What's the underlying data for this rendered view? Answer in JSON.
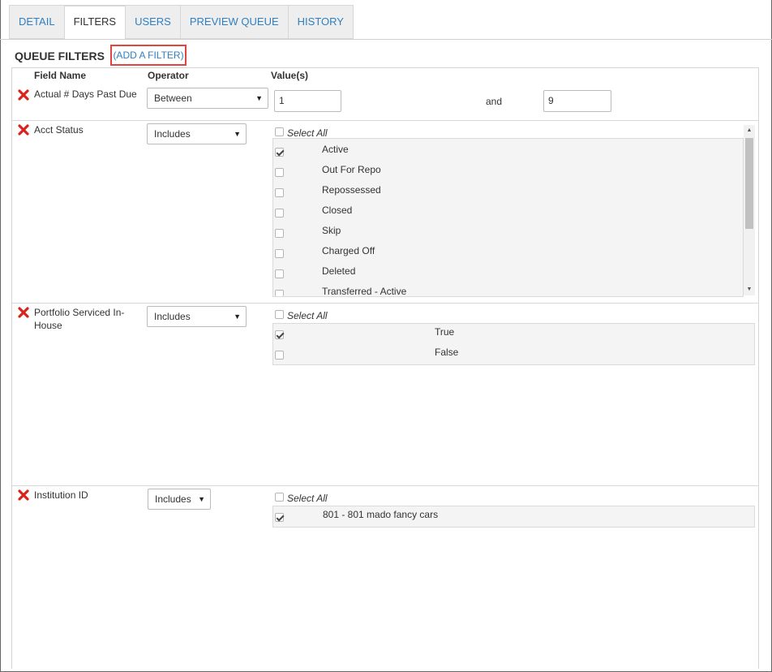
{
  "tabs": [
    {
      "label": "DETAIL",
      "active": false
    },
    {
      "label": "FILTERS",
      "active": true
    },
    {
      "label": "USERS",
      "active": false
    },
    {
      "label": "PREVIEW QUEUE",
      "active": false
    },
    {
      "label": "HISTORY",
      "active": false
    }
  ],
  "queue_filters": {
    "title": "QUEUE FILTERS",
    "add_filter_label": "(ADD A FILTER)"
  },
  "columns": {
    "field_name": "Field Name",
    "operator": "Operator",
    "values": "Value(s)"
  },
  "filters": {
    "days_past_due": {
      "field_name": "Actual # Days Past Due",
      "operator": "Between",
      "value_from": "1",
      "and_label": "and",
      "value_to": "9"
    },
    "acct_status": {
      "field_name": "Acct Status",
      "operator": "Includes",
      "select_all_label": "Select All",
      "options": [
        {
          "label": "Active",
          "checked": true
        },
        {
          "label": "Out For Repo",
          "checked": false
        },
        {
          "label": "Repossessed",
          "checked": false
        },
        {
          "label": "Closed",
          "checked": false
        },
        {
          "label": "Skip",
          "checked": false
        },
        {
          "label": "Charged Off",
          "checked": false
        },
        {
          "label": "Deleted",
          "checked": false
        },
        {
          "label": "Transferred - Active",
          "checked": false
        }
      ]
    },
    "portfolio_inhouse": {
      "field_name": "Portfolio Serviced In-House",
      "operator": "Includes",
      "select_all_label": "Select All",
      "options": [
        {
          "label": "True",
          "checked": true
        },
        {
          "label": "False",
          "checked": false
        }
      ]
    },
    "institution_id": {
      "field_name": "Institution ID",
      "operator": "Includes",
      "select_all_label": "Select All",
      "options": [
        {
          "label": "801 - 801 mado fancy cars",
          "checked": true
        }
      ]
    }
  },
  "icons": {
    "remove": "remove-x-icon",
    "dropdown": "dropdown-arrow-icon"
  },
  "colors": {
    "link": "#2f7fc1",
    "remove_red": "#d9231b",
    "highlight_box": "#e0463d"
  }
}
